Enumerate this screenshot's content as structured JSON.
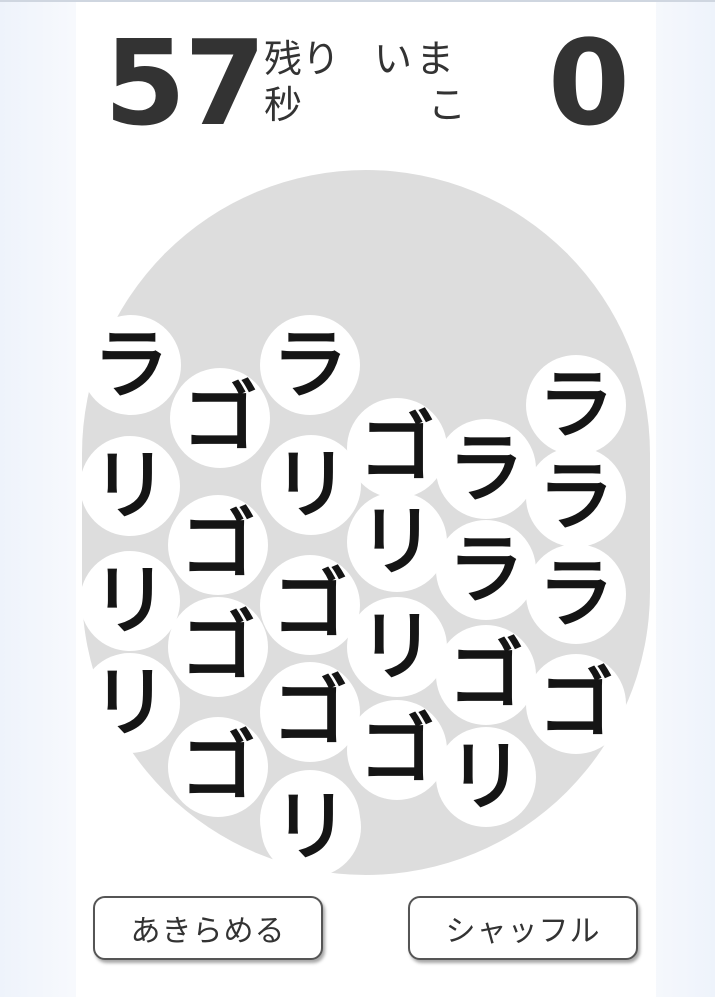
{
  "hud": {
    "timer": "57",
    "timer_label_top": "残り",
    "timer_label_bottom": "秒",
    "current_label_top": "いま",
    "current_label_bottom": "こ",
    "score": "0"
  },
  "balls": [
    {
      "text": "ラ"
    },
    {
      "text": "ゴ"
    },
    {
      "text": "ラ"
    },
    {
      "text": "ゴ"
    },
    {
      "text": "ラ"
    },
    {
      "text": "ラ"
    },
    {
      "text": "リ"
    },
    {
      "text": "リ"
    },
    {
      "text": "リ"
    },
    {
      "text": "ゴ"
    },
    {
      "text": "ラ"
    },
    {
      "text": "ラ"
    },
    {
      "text": "ゴ"
    },
    {
      "text": "リ"
    },
    {
      "text": "リ"
    },
    {
      "text": "ゴ"
    },
    {
      "text": "ゴ"
    },
    {
      "text": "ラ"
    },
    {
      "text": "ゴ"
    },
    {
      "text": "リ"
    },
    {
      "text": "ゴ"
    },
    {
      "text": "ゴ"
    },
    {
      "text": "リ"
    },
    {
      "text": "ゴ"
    },
    {
      "text": "リ"
    },
    {
      "text": "リ"
    }
  ],
  "buttons": {
    "give_up": "あきらめる",
    "shuffle": "シャッフル"
  }
}
